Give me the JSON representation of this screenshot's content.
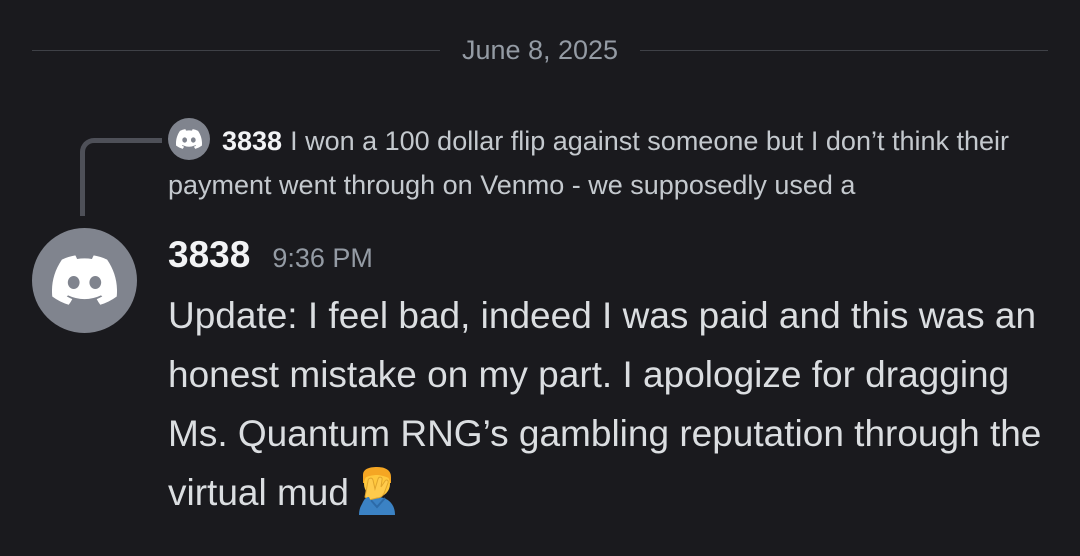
{
  "divider": {
    "date": "June 8, 2025"
  },
  "reply": {
    "author": "3838",
    "text": "I won a 100 dollar flip against someone but I don’t think their payment went through on Venmo - we supposedly used a",
    "avatar_icon": "discord-logo-icon"
  },
  "message": {
    "author": "3838",
    "timestamp": "9:36 PM",
    "text": "Update: I feel bad, indeed I was paid and this was an honest mistake on my part. I apologize for dragging Ms. Quantum RNG’s gambling reputation through the virtual mud",
    "emoji": "man-facepalming-emoji",
    "avatar_icon": "discord-logo-icon"
  },
  "colors": {
    "background": "#1a1a1e",
    "avatar_bg": "#80848e",
    "divider_line": "#3f4147",
    "muted_text": "#949ba4",
    "message_text": "#dbdee1",
    "username": "#f2f3f5"
  }
}
